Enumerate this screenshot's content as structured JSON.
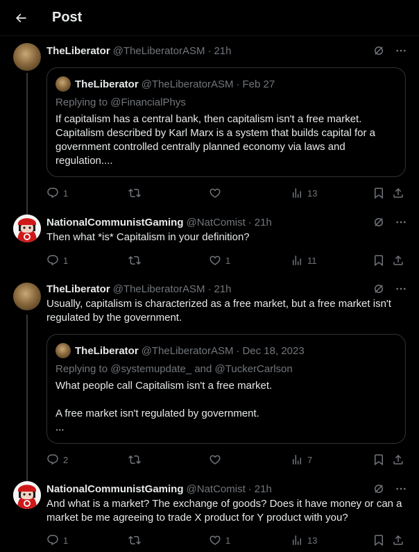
{
  "header": {
    "title": "Post"
  },
  "posts": [
    {
      "name": "TheLiberator",
      "handle": "@TheLiberatorASM",
      "sep": "·",
      "time": "21h",
      "text": "",
      "quote": {
        "name": "TheLiberator",
        "handle": "@TheLiberatorASM",
        "sep": "·",
        "time": "Feb 27",
        "replying": "Replying to @FinancialPhys",
        "text_lines": [
          "If capitalism has a central bank, then capitalism isn't a free market.",
          "Capitalism described by Karl Marx is a system that builds capital for a",
          "government controlled centrally planned economy via laws and",
          "regulation...."
        ]
      },
      "replies": "1",
      "likes": "",
      "views": "13"
    },
    {
      "name": "NationalCommunistGaming",
      "handle": "@NatComist",
      "sep": "·",
      "time": "21h",
      "text": "Then what *is* Capitalism in your definition?",
      "replies": "1",
      "likes": "1",
      "views": "11"
    },
    {
      "name": "TheLiberator",
      "handle": "@TheLiberatorASM",
      "sep": "·",
      "time": "21h",
      "text_lines": [
        "Usually, capitalism is characterized as a free market, but a free market isn't",
        "regulated by the government."
      ],
      "quote": {
        "name": "TheLiberator",
        "handle": "@TheLiberatorASM",
        "sep": "·",
        "time": "Dec 18, 2023",
        "replying": "Replying to @systemupdate_ and @TuckerCarlson",
        "text_lines": [
          "What people call Capitalism isn't a free market.",
          "",
          "A free market isn't regulated by government.",
          "..."
        ]
      },
      "replies": "2",
      "likes": "",
      "views": "7"
    },
    {
      "name": "NationalCommunistGaming",
      "handle": "@NatComist",
      "sep": "·",
      "time": "21h",
      "text_lines": [
        "And what is a market? The exchange of goods? Does it have money or can a",
        "market be me agreeing to trade X product for Y product with you?"
      ],
      "replies": "1",
      "likes": "1",
      "views": "13"
    }
  ],
  "icons": {
    "back": "arrow-left-icon",
    "grok": "grok-icon",
    "more": "more-icon",
    "reply": "reply-icon",
    "repost": "repost-icon",
    "like": "heart-icon",
    "views": "views-icon",
    "bookmark": "bookmark-icon",
    "share": "share-icon"
  },
  "colors": {
    "background": "#000000",
    "text": "#e7e9ea",
    "muted": "#71767b",
    "border": "#2f3336"
  }
}
